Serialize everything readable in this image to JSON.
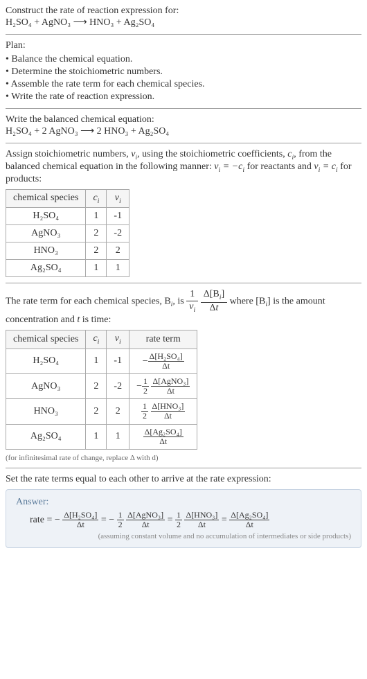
{
  "construct": {
    "title": "Construct the rate of reaction expression for:",
    "equation": "H₂SO₄ + AgNO₃ ⟶ HNO₃ + Ag₂SO₄"
  },
  "plan": {
    "title": "Plan:",
    "items": [
      "Balance the chemical equation.",
      "Determine the stoichiometric numbers.",
      "Assemble the rate term for each chemical species.",
      "Write the rate of reaction expression."
    ]
  },
  "balanced": {
    "title": "Write the balanced chemical equation:",
    "equation": "H₂SO₄ + 2 AgNO₃ ⟶ 2 HNO₃ + Ag₂SO₄"
  },
  "stoich": {
    "intro_a": "Assign stoichiometric numbers, ",
    "intro_b": ", using the stoichiometric coefficients, ",
    "intro_c": ", from the balanced chemical equation in the following manner: ",
    "intro_d": " for reactants and ",
    "intro_e": " for products:",
    "headers": {
      "species": "chemical species",
      "c": "cᵢ",
      "v": "νᵢ"
    },
    "rows": [
      {
        "species": "H₂SO₄",
        "c": "1",
        "v": "-1"
      },
      {
        "species": "AgNO₃",
        "c": "2",
        "v": "-2"
      },
      {
        "species": "HNO₃",
        "c": "2",
        "v": "2"
      },
      {
        "species": "Ag₂SO₄",
        "c": "1",
        "v": "1"
      }
    ]
  },
  "rateterm": {
    "intro_a": "The rate term for each chemical species, B",
    "intro_b": ", is ",
    "intro_c": " where [B",
    "intro_d": "] is the amount concentration and ",
    "intro_e": " is time:",
    "headers": {
      "species": "chemical species",
      "c": "cᵢ",
      "v": "νᵢ",
      "rate": "rate term"
    },
    "rows": [
      {
        "species": "H₂SO₄",
        "c": "1",
        "v": "-1",
        "neg": "−",
        "half": "",
        "num": "Δ[H₂SO₄]",
        "den": "Δt"
      },
      {
        "species": "AgNO₃",
        "c": "2",
        "v": "-2",
        "neg": "−",
        "half": "½",
        "num": "Δ[AgNO₃]",
        "den": "Δt"
      },
      {
        "species": "HNO₃",
        "c": "2",
        "v": "2",
        "neg": "",
        "half": "½",
        "num": "Δ[HNO₃]",
        "den": "Δt"
      },
      {
        "species": "Ag₂SO₄",
        "c": "1",
        "v": "1",
        "neg": "",
        "half": "",
        "num": "Δ[Ag₂SO₄]",
        "den": "Δt"
      }
    ],
    "note": "(for infinitesimal rate of change, replace Δ with d)"
  },
  "finalline": "Set the rate terms equal to each other to arrive at the rate expression:",
  "answer": {
    "label": "Answer:",
    "prefix": "rate = −",
    "t1_num": "Δ[H₂SO₄]",
    "t1_den": "Δt",
    "eq1": " = −",
    "half1_num": "1",
    "half1_den": "2",
    "t2_num": "Δ[AgNO₃]",
    "t2_den": "Δt",
    "eq2": " = ",
    "half2_num": "1",
    "half2_den": "2",
    "t3_num": "Δ[HNO₃]",
    "t3_den": "Δt",
    "eq3": " = ",
    "t4_num": "Δ[Ag₂SO₄]",
    "t4_den": "Δt",
    "note": "(assuming constant volume and no accumulation of intermediates or side products)"
  }
}
